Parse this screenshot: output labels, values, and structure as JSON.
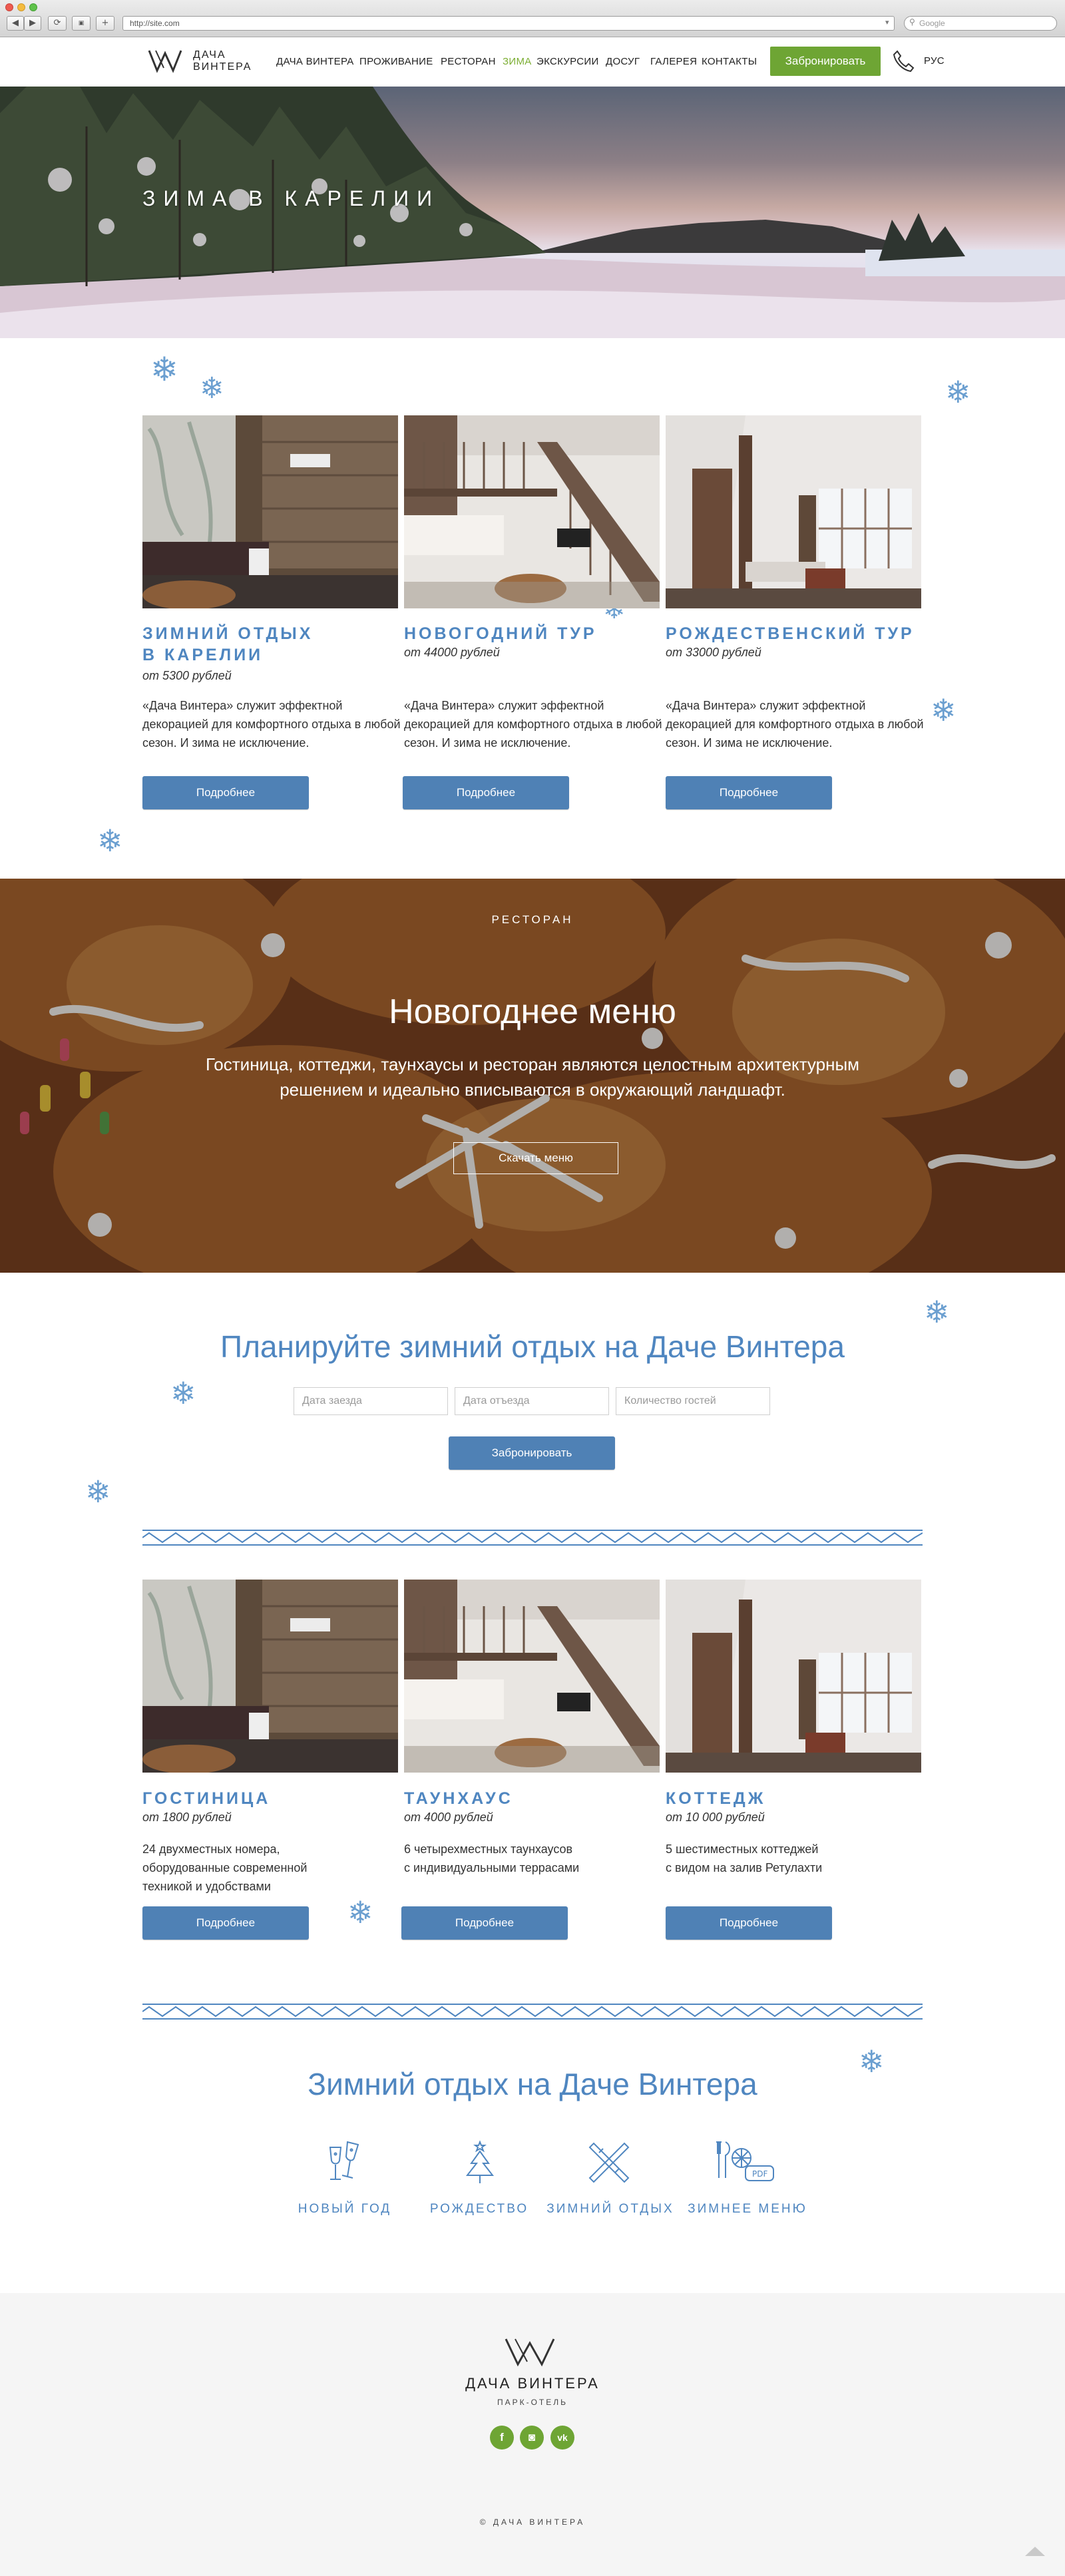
{
  "browser": {
    "url": "http://site.com",
    "search_placeholder": "Google",
    "back": "◀",
    "forward": "▶",
    "reload": "⟳",
    "add_tab": "+"
  },
  "brand": {
    "name_line1": "ДАЧА",
    "name_line2": "ВИНТЕРА",
    "footer_name": "ДАЧА ВИНТЕРА",
    "footer_tagline": "ПАРК-ОТЕЛЬ"
  },
  "nav": {
    "items": [
      "ДАЧА ВИНТЕРА",
      "ПРОЖИВАНИЕ",
      "РЕСТОРАН",
      "ЗИМА",
      "ЭКСКУРСИИ",
      "ДОСУГ",
      "ГАЛЕРЕЯ",
      "КОНТАКТЫ"
    ],
    "active": "ЗИМА",
    "book_label": "Забронировать",
    "language": "РУС"
  },
  "hero": {
    "title": "ЗИМА В КАРЕЛИИ"
  },
  "offers": [
    {
      "title_line1": "ЗИМНИЙ ОТДЫХ",
      "title_line2": "В КАРЕЛИИ",
      "price": "от 5300 рублей",
      "desc": "«Дача Винтера» служит эффектной декорацией для комфортного отдыха в любой сезон. И зима не исключение.",
      "button": "Подробнее"
    },
    {
      "title_line1": "НОВОГОДНИЙ ТУР",
      "title_line2": "",
      "price": "от 44000 рублей",
      "desc": "«Дача Винтера» служит эффектной декорацией для комфортного отдыха в любой сезон. И зима не исключение.",
      "button": "Подробнее"
    },
    {
      "title_line1": "РОЖДЕСТВЕНСКИЙ ТУР",
      "title_line2": "",
      "price": "от 33000 рублей",
      "desc": "«Дача Винтера» служит эффектной декорацией для комфортного отдыха в любой сезон. И зима не исключение.",
      "button": "Подробнее"
    }
  ],
  "restaurant": {
    "eyebrow": "РЕСТОРАН",
    "title": "Новогоднее меню",
    "text_line1": "Гостиница, коттеджи, таунхаусы и ресторан являются целостным архитектурным",
    "text_line2": "решением и идеально вписываются в окружающий ландшафт.",
    "button": "Скачать меню"
  },
  "booking": {
    "title": "Планируйте зимний отдых на Даче Винтера",
    "checkin_placeholder": "Дата заезда",
    "checkout_placeholder": "Дата отъезда",
    "guests_placeholder": "Количество гостей",
    "button": "Забронировать"
  },
  "accommodation": [
    {
      "title": "ГОСТИНИЦА",
      "price": "от 1800 рублей",
      "desc_line1": "24 двухместных номера,",
      "desc_line2": "оборудованные современной",
      "desc_line3": "техникой и удобствами",
      "button": "Подробнее"
    },
    {
      "title": "ТАУНХАУС",
      "price": "от 4000 рублей",
      "desc_line1": "6 четырехместных таунхаусов",
      "desc_line2": "с индивидуальными террасами",
      "desc_line3": "",
      "button": "Подробнее"
    },
    {
      "title": "КОТТЕДЖ",
      "price": "от 10 000 рублей",
      "desc_line1": "5 шестиместных коттеджей",
      "desc_line2": "с видом на залив Ретулахти",
      "desc_line3": "",
      "button": "Подробнее"
    }
  ],
  "winter": {
    "title": "Зимний отдых на Даче Винтера",
    "items": [
      {
        "label": "НОВЫЙ ГОД",
        "icon": "champagne-glasses-icon"
      },
      {
        "label": "РОЖДЕСТВО",
        "icon": "christmas-tree-icon"
      },
      {
        "label": "ЗИМНИЙ ОТДЫХ",
        "icon": "skis-icon"
      },
      {
        "label": "ЗИМНЕЕ МЕНЮ",
        "icon": "pdf-menu-icon"
      }
    ],
    "pdf_label": "PDF"
  },
  "footer": {
    "copyright": "© ДАЧА ВИНТЕРА",
    "social": [
      {
        "name": "facebook",
        "glyph": "f"
      },
      {
        "name": "instagram",
        "glyph": "◙"
      },
      {
        "name": "vkontakte",
        "glyph": "vk"
      }
    ]
  },
  "colors": {
    "accent_blue": "#4f86c0",
    "button_blue": "#4f81b5",
    "brand_green": "#6ea534",
    "active_nav": "#7cae33"
  }
}
